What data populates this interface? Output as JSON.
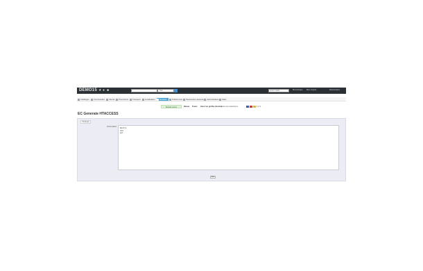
{
  "header": {
    "shop_name": "DEMO15",
    "icons": [
      "cart-icon",
      "user-icon",
      "chat-icon"
    ],
    "search_placeholder": "",
    "search_scope": "Tout",
    "quick_access_placeholder": "Accès rapide",
    "links": [
      "Ma boutique",
      "Mon compte",
      "Déconnexion"
    ]
  },
  "menu": {
    "items": [
      {
        "label": "Catalogue",
        "icon": "book-icon"
      },
      {
        "label": "Commandes",
        "icon": "cart-icon"
      },
      {
        "label": "Clients",
        "icon": "users-icon"
      },
      {
        "label": "Promotions",
        "icon": "tag-icon"
      },
      {
        "label": "Transport",
        "icon": "truck-icon"
      },
      {
        "label": "Localisation",
        "icon": "globe-icon"
      },
      {
        "label": "Modules",
        "icon": "puzzle-icon",
        "active": true
      },
      {
        "label": "Préférences",
        "icon": "gear-icon"
      },
      {
        "label": "Paramètres avancés",
        "icon": "wrench-icon"
      },
      {
        "label": "Administration",
        "icon": "key-icon"
      },
      {
        "label": "Stats",
        "icon": "chart-icon"
      }
    ]
  },
  "status_strip": {
    "module_status": "Module activé",
    "links": [
      "Retour",
      "Tester",
      "Gérer les greffes (Hooks)"
    ],
    "lang_label": "Gérer les traductions",
    "lang_codes": "1 2 3"
  },
  "colors": {
    "header_bg": "#2b3035",
    "active_menu": "#49a2d6",
    "panel_bg": "#ecedf4",
    "success_bg": "#dff0d8"
  },
  "page": {
    "title": "EC Generate HTACCESS",
    "tab_label": "Settings",
    "field_label": "HTACCESS",
    "code_lines": [
      "#extra",
      "",
      "fdd",
      "",
      "",
      "pol"
    ],
    "save_label": "Save"
  }
}
